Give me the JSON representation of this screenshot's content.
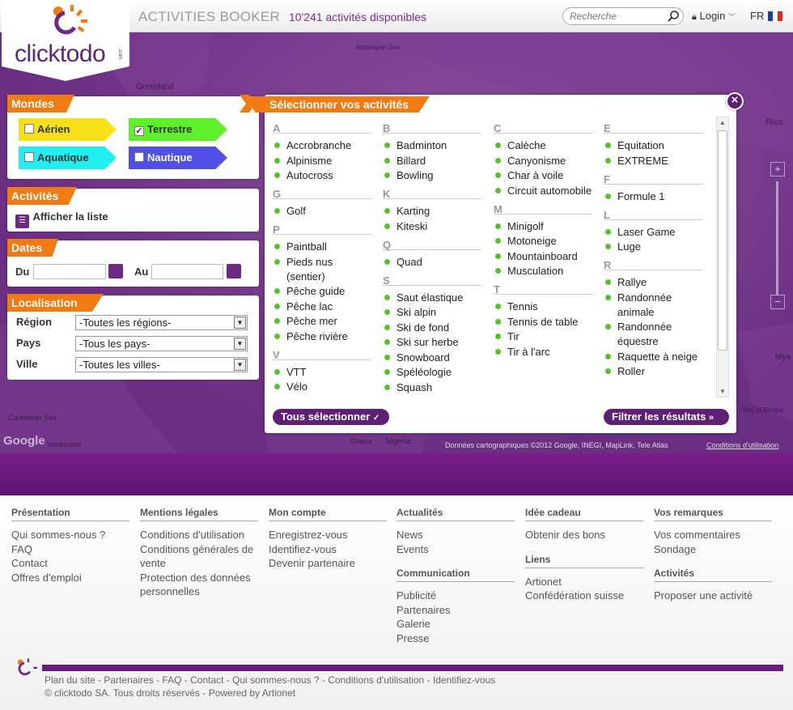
{
  "header": {
    "brand": "clicktodo",
    "brand_suffix": ".com",
    "app_title": "ACTIVITIES BOOKER",
    "activity_count": "10'241 activités disponibles",
    "search_placeholder": "Recherche",
    "login_label": "Login",
    "lang_label": "FR"
  },
  "map": {
    "labels": [
      "Greenland",
      "Norwegian Sea",
      "Caribbean Sea",
      "Venezuela",
      "Ghana",
      "Nigeria",
      "Росс",
      "Mya",
      "Bay of Bengal",
      "Google"
    ],
    "attribution": "Données cartographiques ©2012 Google, INEGI, MapLink, Tele Atlas",
    "terms_link": "Conditions d'utilisation"
  },
  "mondes": {
    "title": "Mondes",
    "items": [
      {
        "label": "Aérien",
        "checked": false,
        "color": "#f9e11a"
      },
      {
        "label": "Terrestre",
        "checked": true,
        "color": "#5ef02a"
      },
      {
        "label": "Aquatique",
        "checked": false,
        "color": "#21eef0"
      },
      {
        "label": "Nautique",
        "checked": false,
        "color": "#5050e6"
      }
    ]
  },
  "activites_panel": {
    "title": "Activités",
    "show_list_label": "Afficher la liste"
  },
  "dates": {
    "title": "Dates",
    "from_label": "Du",
    "to_label": "Au",
    "from_value": "",
    "to_value": ""
  },
  "localisation": {
    "title": "Localisation",
    "region_label": "Région",
    "region_value": "-Toutes les régions-",
    "country_label": "Pays",
    "country_value": "-Tous les pays-",
    "city_label": "Ville",
    "city_value": "-Toutes les villes-"
  },
  "modal": {
    "title": "Sélectionner vos activités",
    "close_label": "×",
    "select_all_label": "Tous sélectionner",
    "filter_label": "Filtrer les résultats",
    "columns": [
      [
        {
          "letter": "A",
          "items": [
            "Accrobranche",
            "Alpinisme",
            "Autocross"
          ]
        },
        {
          "letter": "G",
          "items": [
            "Golf"
          ]
        },
        {
          "letter": "P",
          "items": [
            "Paintball",
            "Pieds nus (sentier)",
            "Pêche guide",
            "Pêche lac",
            "Pêche mer",
            "Pêche rivière"
          ]
        },
        {
          "letter": "V",
          "items": [
            "VTT",
            "Vélo"
          ]
        }
      ],
      [
        {
          "letter": "B",
          "items": [
            "Badminton",
            "Billard",
            "Bowling"
          ]
        },
        {
          "letter": "K",
          "items": [
            "Karting",
            "Kiteski"
          ]
        },
        {
          "letter": "Q",
          "items": [
            "Quad"
          ]
        },
        {
          "letter": "S",
          "items": [
            "Saut élastique",
            "Ski alpin",
            "Ski de fond",
            "Ski sur herbe",
            "Snowboard",
            "Spéléologie",
            "Squash"
          ]
        }
      ],
      [
        {
          "letter": "C",
          "items": [
            "Calèche",
            "Canyonisme",
            "Char à voile",
            "Circuit automobile"
          ]
        },
        {
          "letter": "M",
          "items": [
            "Minigolf",
            "Motoneige",
            "Mountainboard",
            "Musculation"
          ]
        },
        {
          "letter": "T",
          "items": [
            "Tennis",
            "Tennis de table",
            "Tir",
            "Tir à l'arc"
          ]
        }
      ],
      [
        {
          "letter": "E",
          "items": [
            "Equitation",
            "EXTREME"
          ]
        },
        {
          "letter": "F",
          "items": [
            "Formule 1"
          ]
        },
        {
          "letter": "L",
          "items": [
            "Laser Game",
            "Luge"
          ]
        },
        {
          "letter": "R",
          "items": [
            "Rallye",
            "Randonnée animale",
            "Randonnée équestre",
            "Raquette à neige",
            "Roller"
          ]
        }
      ]
    ]
  },
  "footer": {
    "columns": [
      {
        "sections": [
          {
            "title": "Présentation",
            "links": [
              "Qui sommes-nous ?",
              "FAQ",
              "Contact",
              "Offres d'emploi"
            ]
          }
        ]
      },
      {
        "sections": [
          {
            "title": "Mentions légales",
            "links": [
              "Conditions d'utilisation",
              "Conditions générales de vente",
              "Protection des données personnelles"
            ]
          }
        ]
      },
      {
        "sections": [
          {
            "title": "Mon compte",
            "links": [
              "Enregistrez-vous",
              "Identifiez-vous",
              "Devenir partenaire"
            ]
          }
        ]
      },
      {
        "sections": [
          {
            "title": "Actualités",
            "links": [
              "News",
              "Events"
            ]
          },
          {
            "title": "Communication",
            "links": [
              "Publicité",
              "Partenaires",
              "Galerie",
              "Presse"
            ]
          }
        ]
      },
      {
        "sections": [
          {
            "title": "Idée cadeau",
            "links": [
              "Obtenir des bons"
            ]
          },
          {
            "title": "Liens",
            "links": [
              "Artionet",
              "Confédération suisse"
            ]
          }
        ]
      },
      {
        "sections": [
          {
            "title": "Vos remarques",
            "links": [
              "Vos commentaires",
              "Sondage"
            ]
          },
          {
            "title": "Activités",
            "links": [
              "Proposer une activité"
            ]
          }
        ]
      }
    ],
    "bottom_links": [
      "Plan du site",
      "Partenaires",
      "FAQ",
      "Contact",
      "Qui sommes-nous ?",
      "Conditions d'utilisation",
      "Identifiez-vous"
    ],
    "copyright": "© clicktodo SA. Tous droits réservés - Powered by Artionet"
  },
  "colors": {
    "brand_purple": "#6a1c80",
    "accent_orange": "#f07b12",
    "active_green": "#55c12d"
  }
}
